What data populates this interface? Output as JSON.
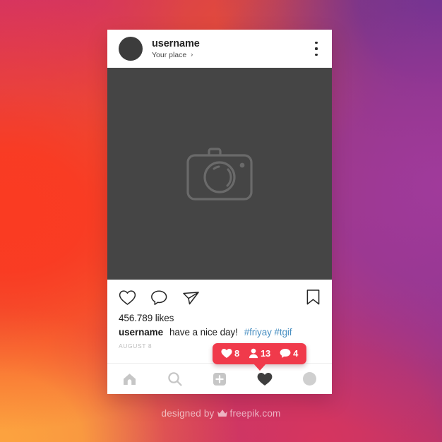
{
  "background": {
    "colors": [
      "#d3375c",
      "#fa3b22",
      "#fca03f",
      "#a03a9b",
      "#6b3494"
    ]
  },
  "post": {
    "header": {
      "avatar_icon": "avatar-circle",
      "username": "username",
      "location": "Your place",
      "location_chevron": "›",
      "menu_icon": "more-options-icon"
    },
    "photo": {
      "placeholder_icon": "camera-icon",
      "background_color": "#454545"
    },
    "actions": {
      "like_icon": "heart-outline-icon",
      "comment_icon": "comment-outline-icon",
      "share_icon": "send-outline-icon",
      "save_icon": "bookmark-outline-icon"
    },
    "likes": "456.789 likes",
    "caption": {
      "username": "username",
      "text": "have a nice day!",
      "tags": "#friyay #tgif",
      "tag_color": "#4a90c2"
    },
    "timestamp": "AUGUST 8"
  },
  "notification": {
    "background_color": "#f03a4b",
    "items": [
      {
        "icon": "heart-filled-icon",
        "value": "8"
      },
      {
        "icon": "person-filled-icon",
        "value": "13"
      },
      {
        "icon": "comment-filled-icon",
        "value": "4"
      }
    ]
  },
  "navbar": {
    "items": [
      {
        "icon": "home-icon",
        "active": "false"
      },
      {
        "icon": "search-icon",
        "active": "false"
      },
      {
        "icon": "add-post-icon",
        "active": "false"
      },
      {
        "icon": "heart-filled-icon",
        "active": "true"
      },
      {
        "icon": "profile-avatar-icon",
        "active": "false"
      }
    ]
  },
  "credit": {
    "prefix": "designed by",
    "icon": "freepik-crown-icon",
    "brand": "freepik.com"
  }
}
